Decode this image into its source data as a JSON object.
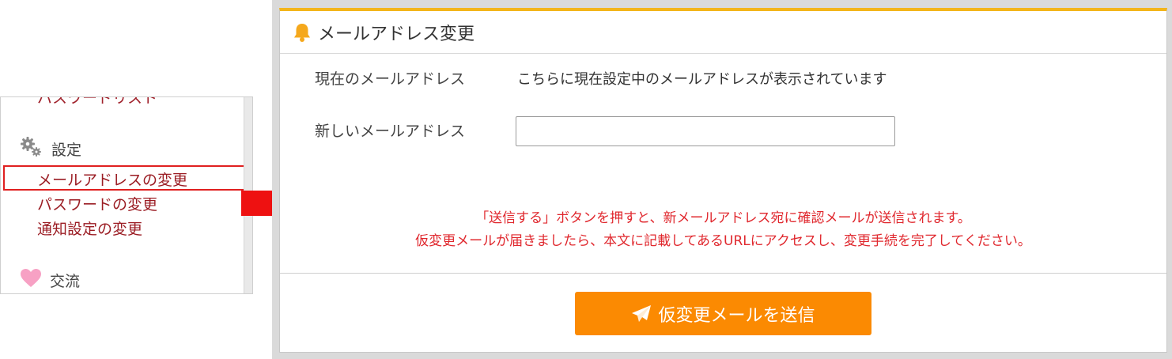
{
  "sidebar": {
    "clipped_item": "パスワードリスト",
    "settings_heading": "設定",
    "links": {
      "change_email": "メールアドレスの変更",
      "change_password": "パスワードの変更",
      "change_notifications": "通知設定の変更"
    },
    "exchange_heading": "交流"
  },
  "panel": {
    "title": "メールアドレス変更",
    "current_email_label": "現在のメールアドレス",
    "current_email_value": "こちらに現在設定中のメールアドレスが表示されています",
    "new_email_label": "新しいメールアドレス",
    "new_email_value": "",
    "notice_line1": "「送信する」ボタンを押すと、新メールアドレス宛に確認メールが送信されます。",
    "notice_line2": "仮変更メールが届きましたら、本文に記載してあるURLにアクセスし、変更手続を完了してください。",
    "submit_label": "仮変更メールを送信"
  },
  "icons": {
    "settings": "gears-icon",
    "exchange": "heart-icon",
    "header": "bell-icon",
    "submit": "paper-plane-icon",
    "pointer": "right-arrow-icon"
  },
  "colors": {
    "accent_bar": "#f3b51a",
    "link": "#9b1d24",
    "highlight_box": "#e02020",
    "notice_text": "#e0282e",
    "button": "#fb8a02"
  }
}
